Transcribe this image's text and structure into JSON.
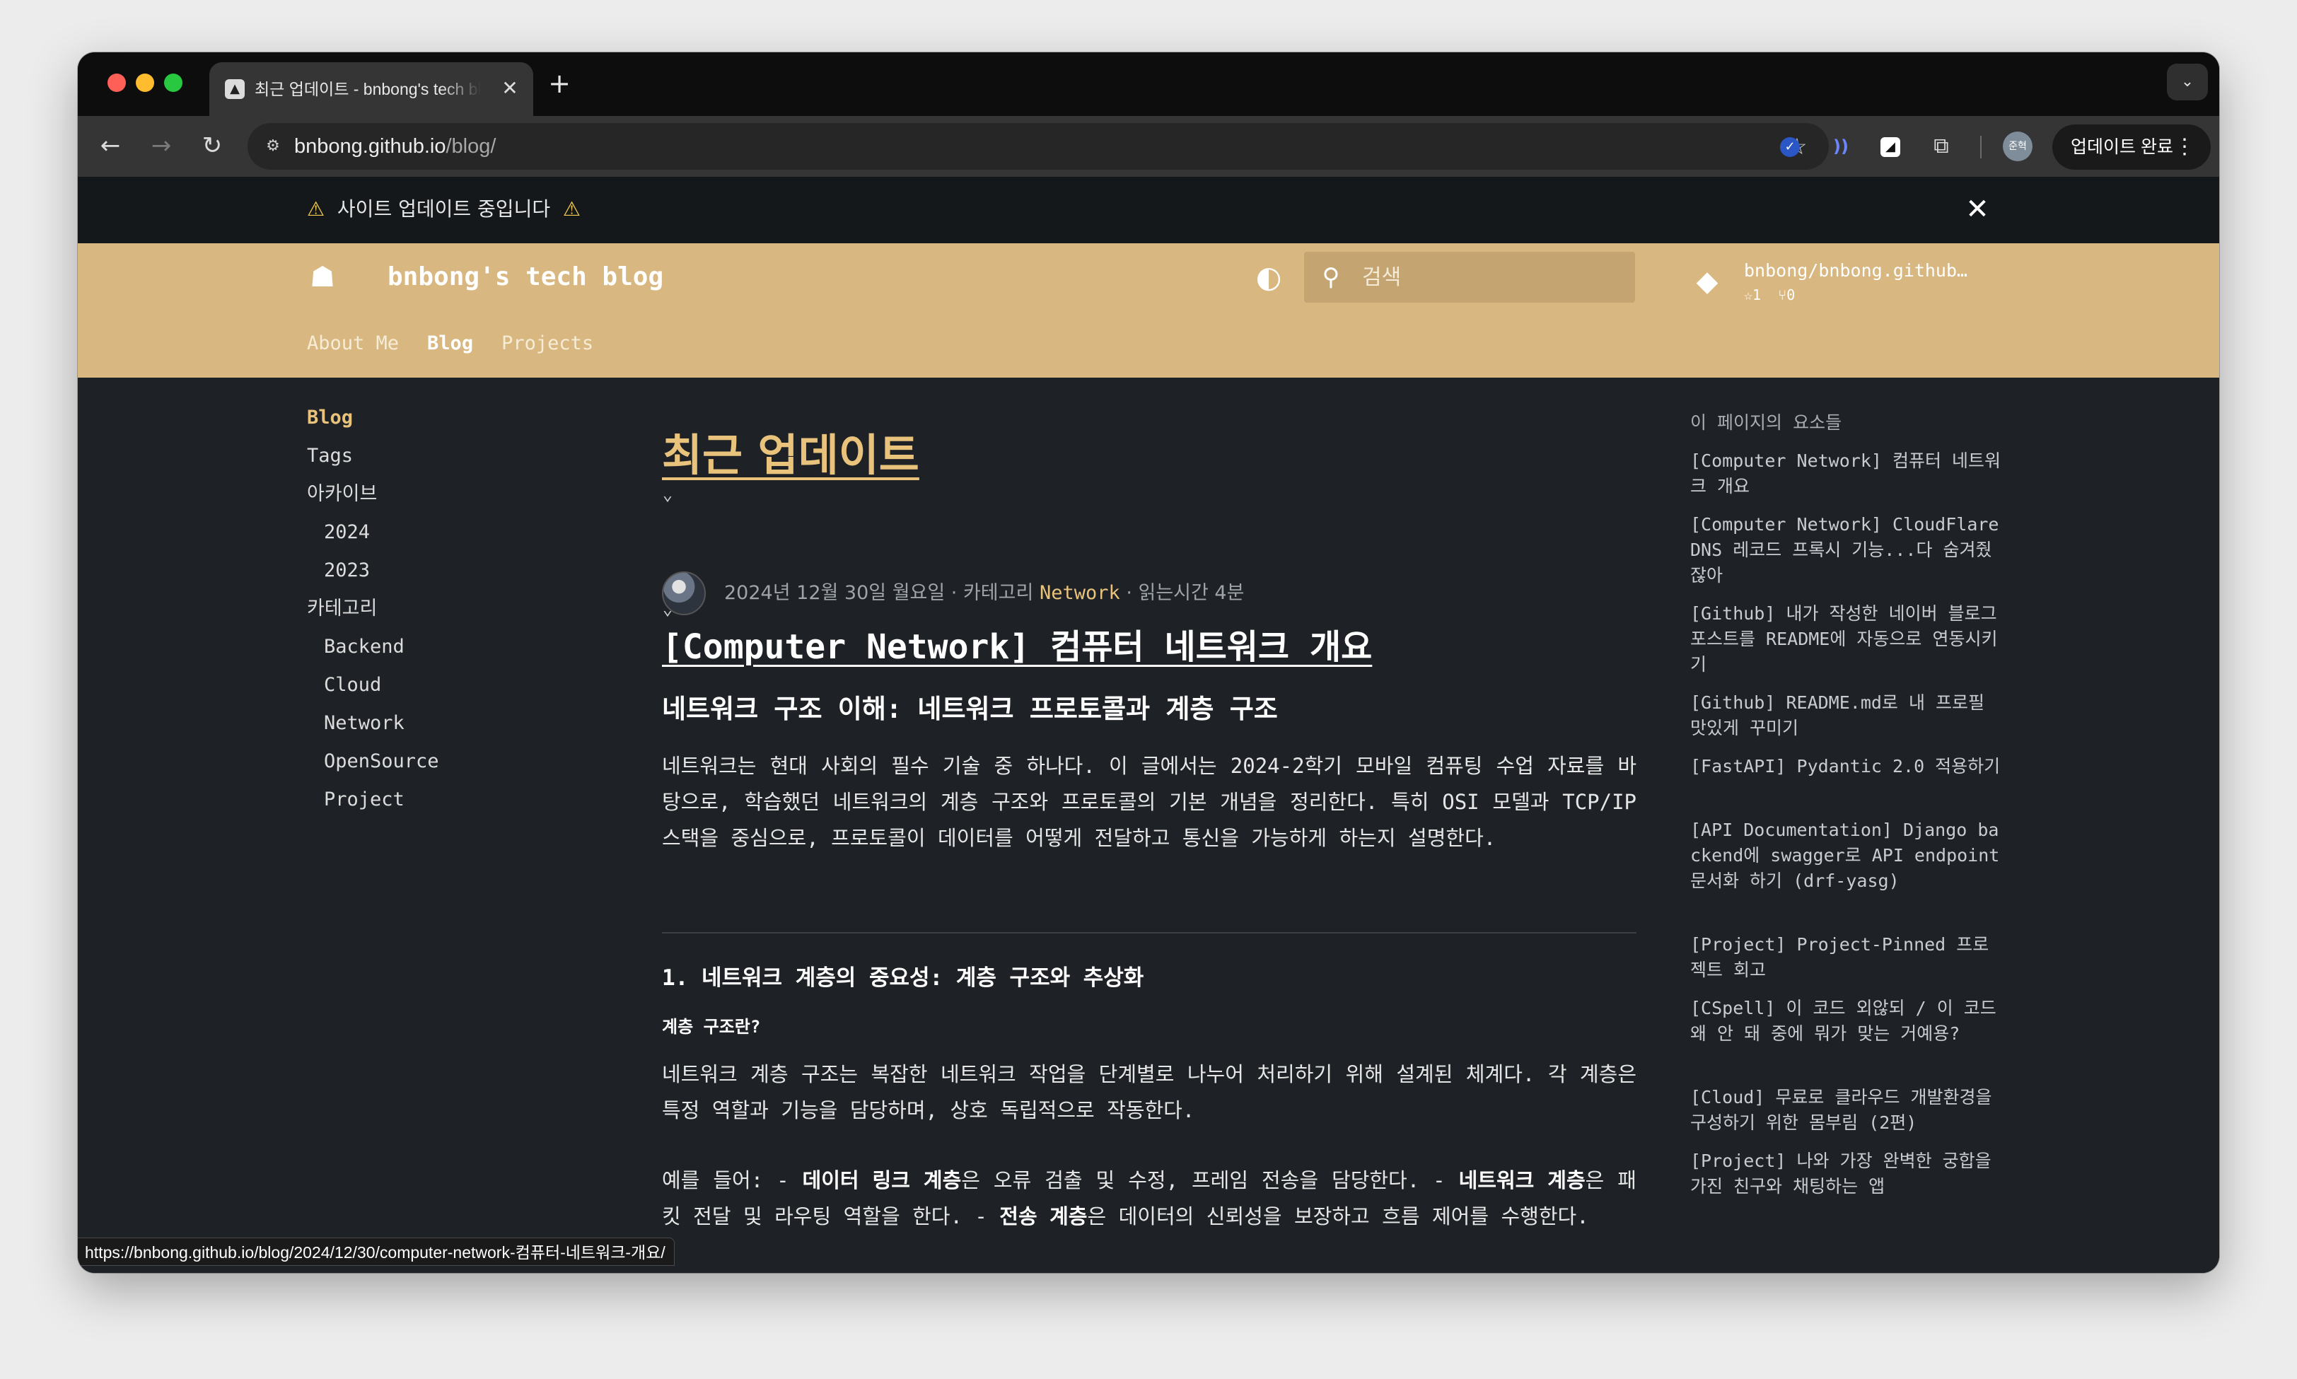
{
  "browser": {
    "tab_title": "최근 업데이트 - bnbong's tech blog",
    "url_host": "bnbong.github.io",
    "url_path": "/blog/",
    "profile_label": "준혁",
    "update_button_label": "업데이트 완료",
    "status_url": "https://bnbong.github.io/blog/2024/12/30/computer-network-컴퓨터-네트워크-개요/"
  },
  "notice": {
    "text": "사이트 업데이트 중입니다"
  },
  "header": {
    "site_title": "bnbong's tech blog",
    "search_placeholder": "검색",
    "repo_name": "bnbong/bnbong.github…",
    "repo_stars": "1",
    "repo_forks": "0",
    "nav": [
      "About Me",
      "Blog",
      "Projects"
    ],
    "active_nav": "Blog",
    "accent_color": "#d8b880"
  },
  "sidebar": {
    "blog": "Blog",
    "tags": "Tags",
    "archive": "아카이브",
    "archive_years": [
      "2024",
      "2023"
    ],
    "category": "카테고리",
    "categories": [
      "Backend",
      "Cloud",
      "Network",
      "OpenSource",
      "Project"
    ]
  },
  "main": {
    "page_title": "최근 업데이트",
    "post": {
      "date": "2024년 12월 30일 월요일",
      "category_prefix": "카테고리",
      "category": "Network",
      "read_time": "읽는시간 4분",
      "title": "[Computer Network] 컴퓨터 네트워크 개요",
      "subtitle": "네트워크 구조 이해: 네트워크 프로토콜과 계층 구조",
      "intro": "네트워크는 현대 사회의 필수 기술 중 하나다. 이 글에서는 2024-2학기 모바일 컴퓨팅 수업 자료를 바탕으로, 학습했던 네트워크의 계층 구조와 프로토콜의 기본 개념을 정리한다. 특히 OSI 모델과 TCP/IP 스택을 중심으로, 프로토콜이 데이터를 어떻게 전달하고 통신을 가능하게 하는지 설명한다.",
      "section_heading": "1. 네트워크 계층의 중요성: 계층 구조와 추상화",
      "sub_heading": "계층 구조란?",
      "section_para": "네트워크 계층 구조는 복잡한 네트워크 작업을 단계별로 나누어 처리하기 위해 설계된 체계다. 각 계층은 특정 역할과 기능을 담당하며, 상호 독립적으로 작동한다.",
      "example_prefix": "예를 들어: - ",
      "example_b1": "데이터 링크 계층",
      "example_t1": "은 오류 검출 및 수정, 프레임 전송을 담당한다. - ",
      "example_b2": "네트워크 계층",
      "example_t2": "은 패킷 전달 및 라우팅 역할을 한다. - ",
      "example_b3": "전송 계층",
      "example_t3": "은 데이터의 신뢰성을 보장하고 흐름 제어를 수행한다."
    }
  },
  "toc": {
    "title": "이 페이지의 요소들",
    "items": [
      "[Computer Network] 컴퓨터 네트워크 개요",
      "[Computer Network] CloudFlare DNS 레코드 프록시 기능...다 숨겨줬잖아",
      "[Github] 내가 작성한 네이버 블로그 포스트를 README에 자동으로 연동시키기",
      "[Github] README.md로 내 프로필 맛있게 꾸미기",
      "[FastAPI] Pydantic 2.0 적용하기",
      "[API Documentation] Django backend에 swagger로 API endpoint 문서화 하기 (drf-yasg)",
      "[Project] Project-Pinned 프로젝트 회고",
      "[CSpell] 이 코드 외않되 / 이 코드 왜 안 돼 중에 뭐가 맞는 거예용?",
      "[Cloud] 무료로 클라우드 개발환경을 구성하기 위한 몸부림 (2편)",
      "[Project] 나와 가장 완벽한 궁합을 가진 친구와 채팅하는 앱"
    ]
  }
}
